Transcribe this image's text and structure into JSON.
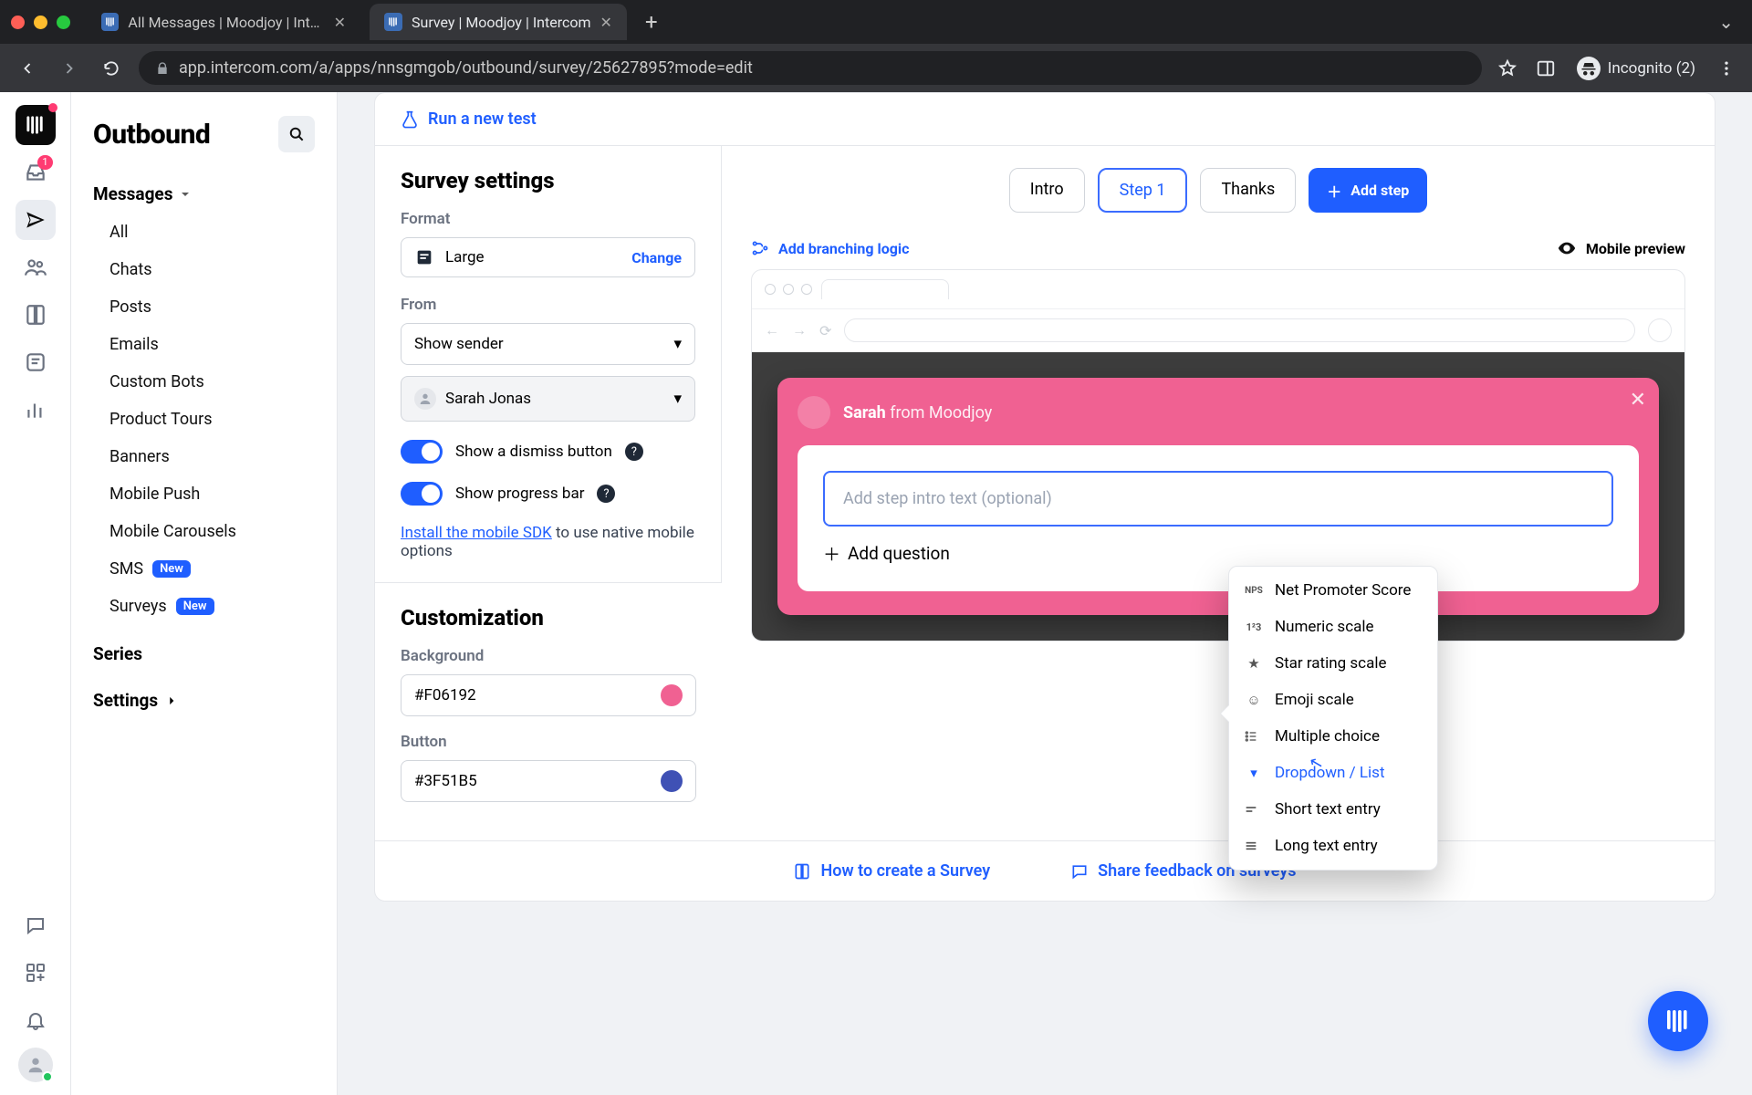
{
  "browser": {
    "tabs": [
      {
        "title": "All Messages | Moodjoy | Interc",
        "active": false
      },
      {
        "title": "Survey | Moodjoy | Intercom",
        "active": true
      }
    ],
    "url": "app.intercom.com/a/apps/nnsgmgob/outbound/survey/25627895?mode=edit",
    "incognito_label": "Incognito (2)"
  },
  "rail": {
    "inbox_badge": "1"
  },
  "sidebar": {
    "title": "Outbound",
    "messages_label": "Messages",
    "items": [
      "All",
      "Chats",
      "Posts",
      "Emails",
      "Custom Bots",
      "Product Tours",
      "Banners",
      "Mobile Push",
      "Mobile Carousels"
    ],
    "sms": {
      "label": "SMS",
      "pill": "New"
    },
    "surveys": {
      "label": "Surveys",
      "pill": "New"
    },
    "series_label": "Series",
    "settings_label": "Settings"
  },
  "test_row": {
    "run_test": "Run a new test"
  },
  "settings": {
    "heading": "Survey settings",
    "format_label": "Format",
    "format_value": "Large",
    "change_label": "Change",
    "from_label": "From",
    "show_sender": "Show sender",
    "sender_name": "Sarah Jonas",
    "dismiss_label": "Show a dismiss button",
    "progress_label": "Show progress bar",
    "install_link": "Install the mobile SDK",
    "install_rest": " to use native mobile options"
  },
  "customization": {
    "heading": "Customization",
    "bg_label": "Background",
    "bg_value": "#F06192",
    "btn_label": "Button",
    "btn_value": "#3F51B5"
  },
  "preview": {
    "steps": [
      "Intro",
      "Step 1",
      "Thanks"
    ],
    "active_step_index": 1,
    "add_step": "Add step",
    "branching": "Add branching logic",
    "mobile_preview": "Mobile preview",
    "survey": {
      "sender_name": "Sarah",
      "from_text": "from Moodjoy",
      "intro_placeholder": "Add step intro text (optional)",
      "add_question": "Add question"
    },
    "question_types": [
      {
        "icon": "NPS",
        "label": "Net Promoter Score"
      },
      {
        "icon": "123",
        "label": "Numeric scale"
      },
      {
        "icon": "star",
        "label": "Star rating scale"
      },
      {
        "icon": "emoji",
        "label": "Emoji scale"
      },
      {
        "icon": "mc",
        "label": "Multiple choice"
      },
      {
        "icon": "dd",
        "label": "Dropdown / List"
      },
      {
        "icon": "short",
        "label": "Short text entry"
      },
      {
        "icon": "long",
        "label": "Long text entry"
      }
    ],
    "hover_index": 5
  },
  "footer": {
    "howto": "How to create a Survey",
    "feedback": "Share feedback on surveys"
  }
}
